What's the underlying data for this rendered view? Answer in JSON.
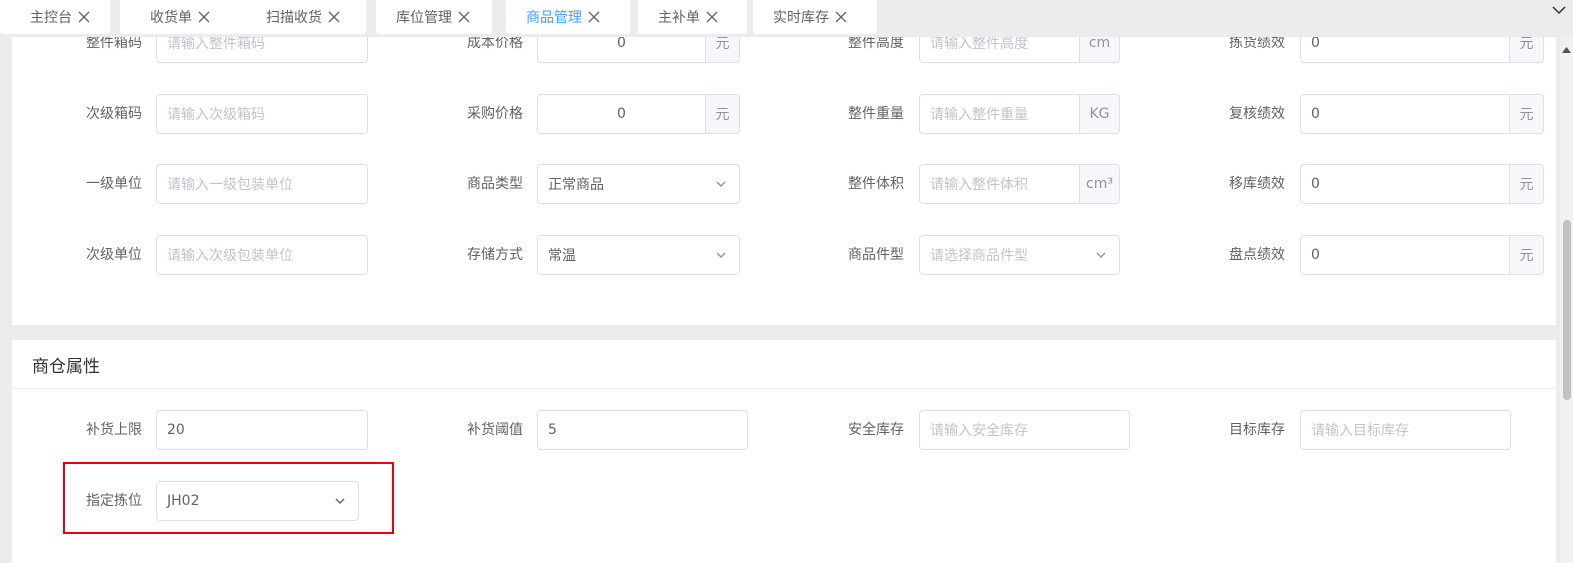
{
  "tabs": [
    {
      "label": "主控台",
      "active": false
    },
    {
      "label": "收货单",
      "active": false
    },
    {
      "label": "扫描收货",
      "active": false
    },
    {
      "label": "库位管理",
      "active": false
    },
    {
      "label": "商品管理",
      "active": true
    },
    {
      "label": "主补单",
      "active": false
    },
    {
      "label": "实时库存",
      "active": false
    }
  ],
  "colors": {
    "accent": "#409eff",
    "highlight": "#e60012"
  },
  "basic_rows": [
    [
      {
        "label": "整件箱码",
        "placeholder": "请输入整件箱码"
      },
      {
        "label": "成本价格",
        "value": "0",
        "unit": "元"
      },
      {
        "label": "整件高度",
        "placeholder": "请输入整件高度",
        "unit": "cm"
      },
      {
        "label": "拣货绩效",
        "value": "0",
        "unit": "元"
      }
    ],
    [
      {
        "label": "次级箱码",
        "placeholder": "请输入次级箱码"
      },
      {
        "label": "采购价格",
        "value": "0",
        "unit": "元"
      },
      {
        "label": "整件重量",
        "placeholder": "请输入整件重量",
        "unit": "KG"
      },
      {
        "label": "复核绩效",
        "value": "0",
        "unit": "元"
      }
    ],
    [
      {
        "label": "一级单位",
        "placeholder": "请输入一级包装单位"
      },
      {
        "label": "商品类型",
        "value": "正常商品",
        "select": true
      },
      {
        "label": "整件体积",
        "placeholder": "请输入整件体积",
        "unit": "cm³"
      },
      {
        "label": "移库绩效",
        "value": "0",
        "unit": "元"
      }
    ],
    [
      {
        "label": "次级单位",
        "placeholder": "请输入次级包装单位"
      },
      {
        "label": "存储方式",
        "value": "常温",
        "select": true
      },
      {
        "label": "商品件型",
        "placeholder": "请选择商品件型",
        "select": true
      },
      {
        "label": "盘点绩效",
        "value": "0",
        "unit": "元"
      }
    ]
  ],
  "warehouse_section": {
    "title": "商仓属性",
    "fields": [
      {
        "label": "补货上限",
        "value": "20"
      },
      {
        "label": "补货阈值",
        "value": "5"
      },
      {
        "label": "安全库存",
        "placeholder": "请输入安全库存"
      },
      {
        "label": "目标库存",
        "placeholder": "请输入目标库存"
      },
      {
        "label": "指定拣位",
        "value": "JH02",
        "select": true
      }
    ]
  }
}
